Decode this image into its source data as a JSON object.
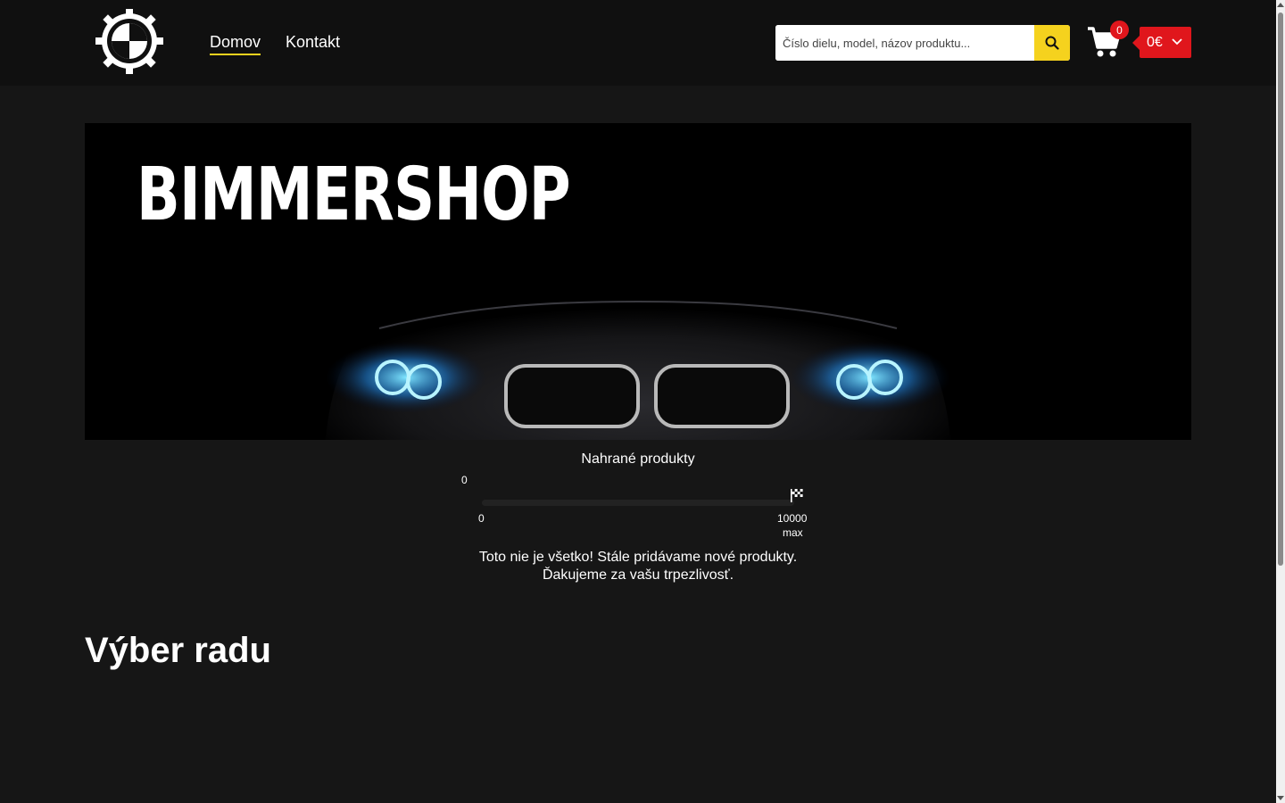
{
  "header": {
    "logo_text": "BIMMER SHOP",
    "nav": [
      {
        "label": "Domov",
        "active": true
      },
      {
        "label": "Kontakt",
        "active": false
      }
    ],
    "search": {
      "placeholder": "Číslo dielu, model, názov produktu...",
      "value": ""
    },
    "cart": {
      "count": "0",
      "total": "0€"
    }
  },
  "hero": {
    "title": "BIMMERSHOP"
  },
  "progress": {
    "title": "Nahrané produkty",
    "current": "0",
    "min_label": "0",
    "max_value": "10000",
    "max_label": "max",
    "fraction": 0
  },
  "notice": {
    "line1": "Toto nie je všetko! Stále pridávame nové produkty.",
    "line2": "Ďakujeme za vašu trpezlivosť."
  },
  "section": {
    "title": "Výber radu"
  },
  "colors": {
    "accent": "#f5d21e",
    "cart_red": "#e0161c",
    "background": "#161616",
    "header": "#101010"
  }
}
